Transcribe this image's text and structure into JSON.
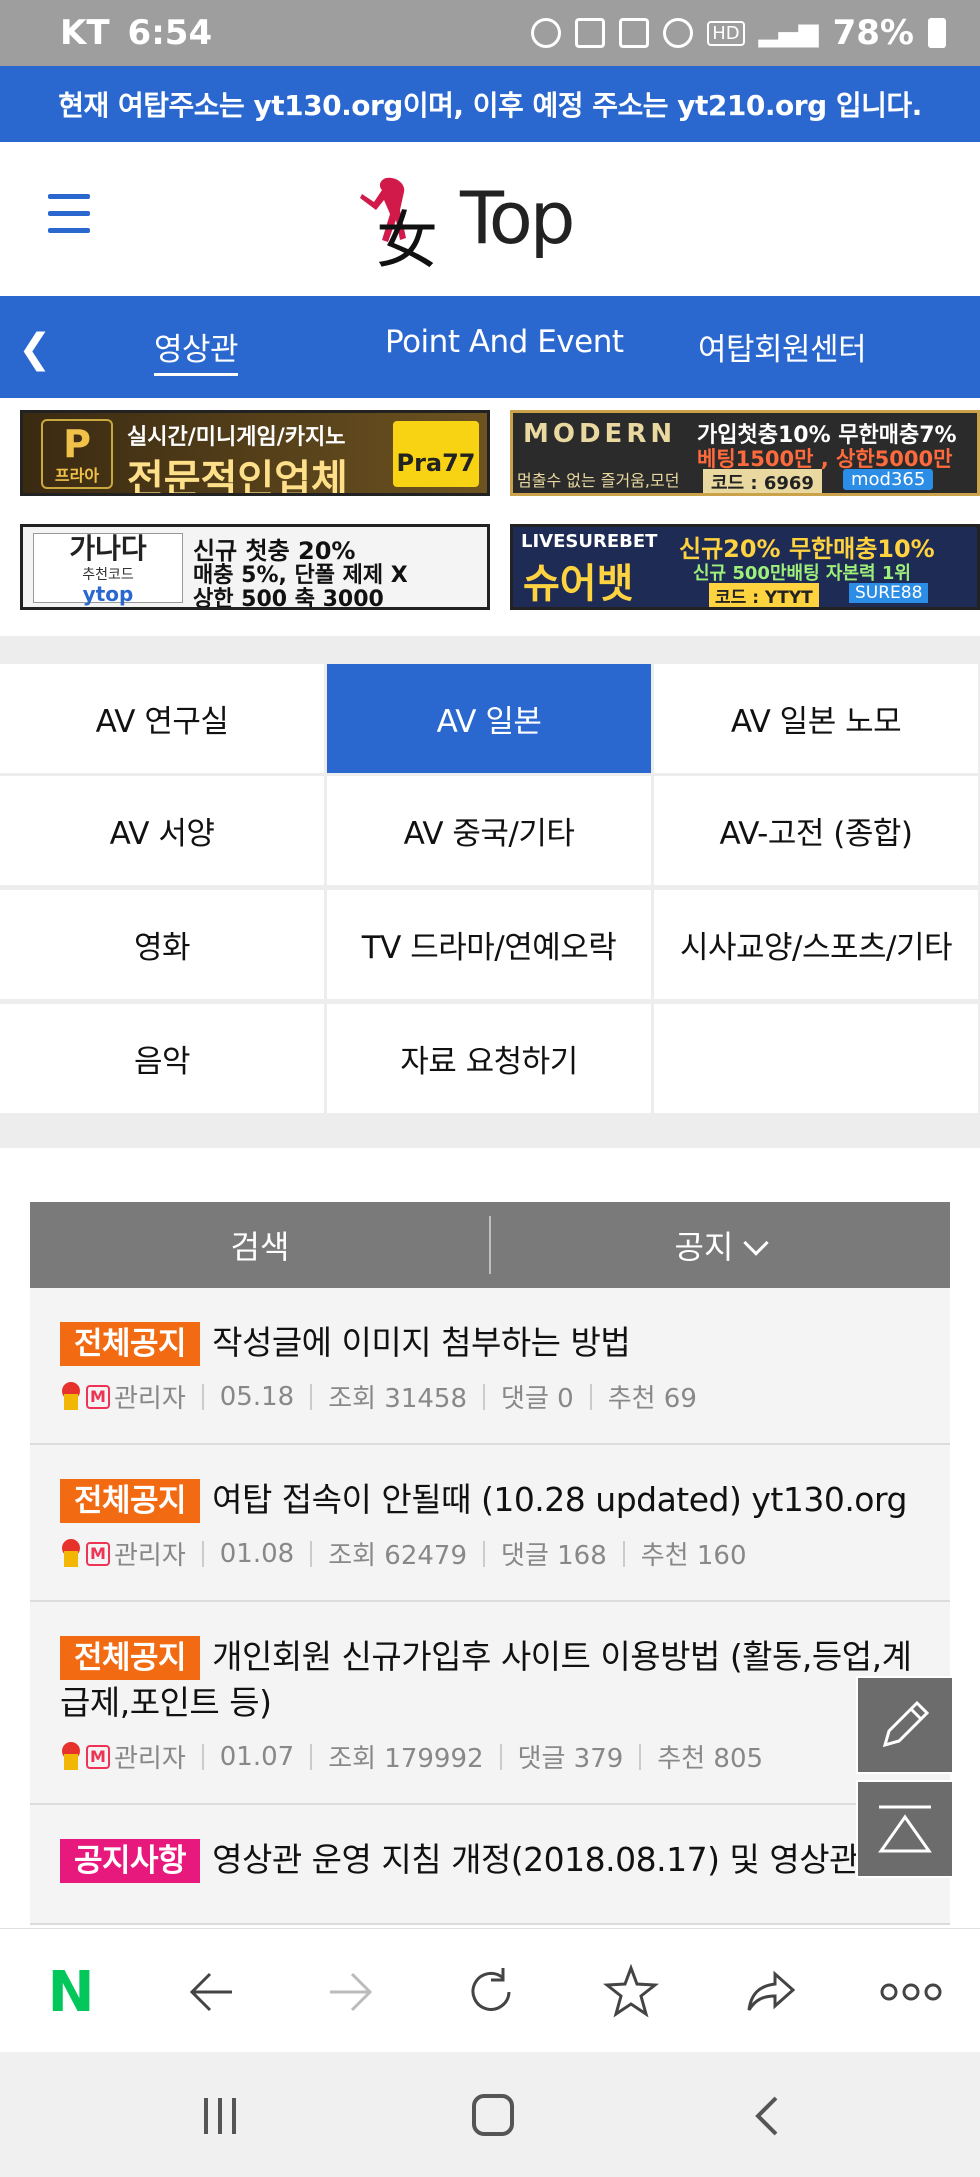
{
  "status_bar": {
    "carrier": "KT",
    "time": "6:54",
    "battery": "78%",
    "hd": "HD"
  },
  "notice": {
    "text": "현재 여탑주소는 yt130.org이며, 이후 예정 주소는 yt210.org 입니다."
  },
  "header": {
    "logo_text": "Top",
    "logo_han": "女"
  },
  "nav": {
    "tabs": [
      "영상관",
      "Point And Event",
      "여탑회원센터"
    ]
  },
  "banners": {
    "b1": {
      "line1": "실시간/미니게임/카지노",
      "line2": "전문적인업체",
      "badge": "P",
      "badge_sub": "프라아",
      "talk": "Pra77"
    },
    "b2": {
      "brand": "MODERN",
      "line1": "가입첫충10% 무한매충7%",
      "line2": "베팅1500만 , 상한5000만",
      "line3": "멈출수 없는 즐거움,모던",
      "code": "코드 : 6969",
      "handle": "mod365"
    },
    "b3": {
      "brand": "가나다",
      "sub": "추천코드",
      "code": "ytop",
      "line1": "신규 첫충 20%",
      "line2": "매충 5%, 단폴 제제 X",
      "line3": "상한 500 축 3000"
    },
    "b4": {
      "brand": "LIVESUREBET",
      "name": "슈어뱃",
      "line1": "신규20% 무한매충10%",
      "line2": "신규 500만배팅 자본력 1위",
      "code": "코드 : YTYT",
      "handle": "SURE88"
    }
  },
  "categories": [
    "AV 연구실",
    "AV 일본",
    "AV 일본 노모",
    "AV 서양",
    "AV 중국/기타",
    "AV-고전 (종합)",
    "영화",
    "TV 드라마/연예오락",
    "시사교양/스포츠/기타",
    "음악",
    "자료 요청하기",
    ""
  ],
  "active_category": "AV 일본",
  "toolbar": {
    "search": "검색",
    "notice": "공지"
  },
  "posts": [
    {
      "tag": "전체공지",
      "title": "작성글에 이미지 첨부하는 방법",
      "author": "관리자",
      "date": "05.18",
      "views": "조회 31458",
      "comments": "댓글 0",
      "likes": "추천 69"
    },
    {
      "tag": "전체공지",
      "title": "여탑 접속이 안될때 (10.28 updated) yt130.org",
      "author": "관리자",
      "date": "01.08",
      "views": "조회 62479",
      "comments": "댓글 168",
      "likes": "추천 160"
    },
    {
      "tag": "전체공지",
      "title": "개인회원 신규가입후 사이트 이용방법 (활동,등업,계급제,포인트 등)",
      "author": "관리자",
      "date": "01.07",
      "views": "조회 179992",
      "comments": "댓글 379",
      "likes": "추천 805"
    },
    {
      "tag": "공지사항",
      "title": "영상관 운영 지침 개정(2018.08.17) 및 영상관",
      "author": "",
      "date": "",
      "views": "",
      "comments": "",
      "likes": ""
    }
  ],
  "browser": {
    "n_logo": "N"
  },
  "colors": {
    "brand_blue": "#2a68d0",
    "tag_orange": "#f26a12",
    "tag_pink": "#e8197c",
    "toolbar_gray": "#7a7a7a"
  }
}
